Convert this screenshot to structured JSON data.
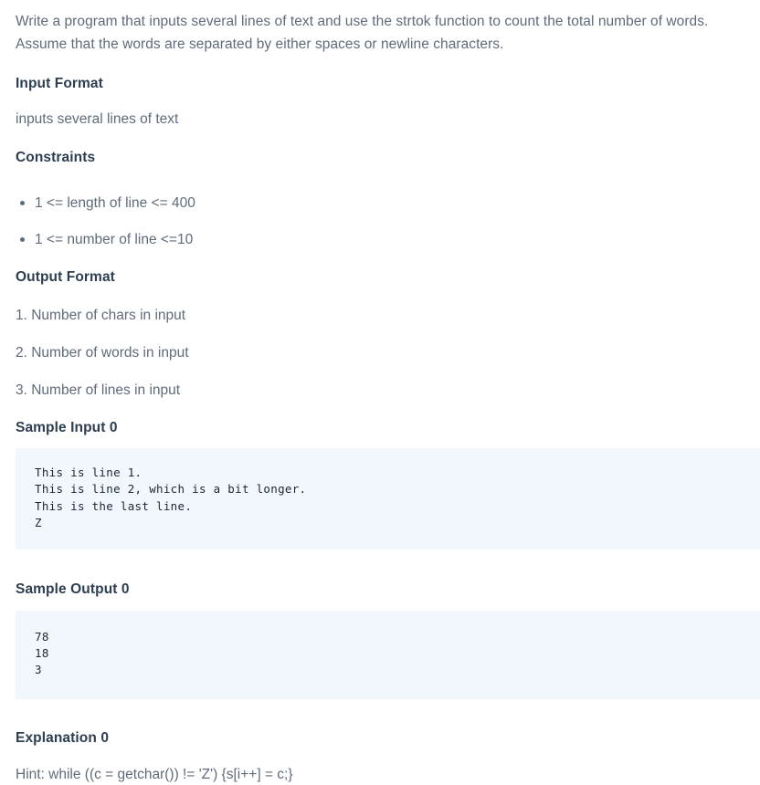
{
  "problem": {
    "statement": "Write a program that inputs several lines of text and use the strtok function to count the total number of words. Assume that the words are separated by either spaces or newline characters."
  },
  "input_format": {
    "heading": "Input Format",
    "text": "inputs several lines of text"
  },
  "constraints": {
    "heading": "Constraints",
    "items": [
      "1 <= length of line <= 400",
      "1 <= number of line <=10"
    ]
  },
  "output_format": {
    "heading": "Output Format",
    "items": [
      "1. Number of chars in input",
      "2. Number of words in input",
      "3. Number of lines in input"
    ]
  },
  "sample_input": {
    "heading": "Sample Input 0",
    "code": "This is line 1.\nThis is line 2, which is a bit longer.\nThis is the last line.\nZ"
  },
  "sample_output": {
    "heading": "Sample Output 0",
    "code": "78\n18\n3"
  },
  "explanation": {
    "heading": "Explanation 0",
    "text": "Hint: while ((c = getchar()) != 'Z') {s[i++] = c;}"
  },
  "colors": {
    "heading_text": "#2c3e50",
    "body_text": "#5f6b7a",
    "code_background": "#f2f7fd",
    "code_text": "#1b2733",
    "page_background": "#ffffff"
  }
}
